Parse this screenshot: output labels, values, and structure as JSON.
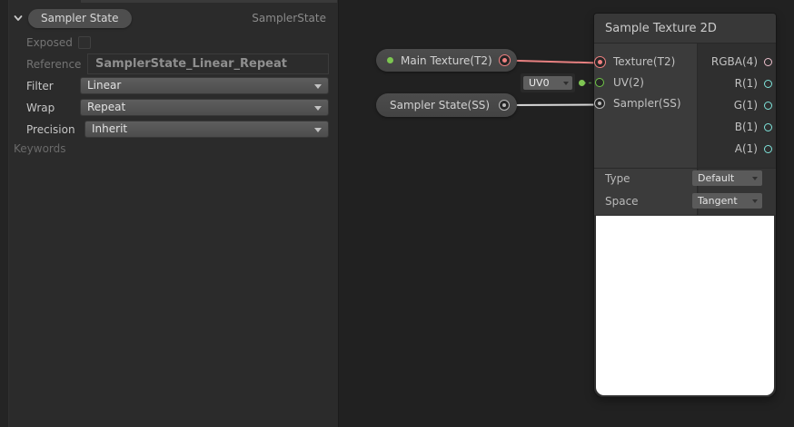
{
  "colors": {
    "graph_background": "#212121",
    "panel_background": "#2b2b2b",
    "node_header": "#383838",
    "node_body": "#2f2f2f",
    "input_column": "#3b3b3b",
    "pill_background": "#484848",
    "texture_port": "#f08080",
    "uv_port": "#6fc846",
    "exposed_dot_green": "#7cc651",
    "sampler_port": "#b9b9b9",
    "vector4_port": "#eec1ce",
    "float_port": "#7fe5dc",
    "edge_texture": "#e88181",
    "edge_uv_dashed": "#4e7c40",
    "edge_sampler": "#d9d9d9",
    "preview_background": "#ffffff"
  },
  "inspector": {
    "property_pill_label": "Sampler State",
    "property_type_label": "SamplerState",
    "exposed_label": "Exposed",
    "reference_label": "Reference",
    "reference_value": "SamplerState_Linear_Repeat",
    "filter_label": "Filter",
    "filter_value": "Linear",
    "wrap_label": "Wrap",
    "wrap_value": "Repeat",
    "precision_label": "Precision",
    "precision_value": "Inherit",
    "keywords_label": "Keywords"
  },
  "graph": {
    "main_texture_node": {
      "label": "Main Texture(T2)"
    },
    "uv_dropdown": {
      "value": "UV0"
    },
    "sampler_state_node": {
      "label": "Sampler State(SS)"
    },
    "sample_texture_node": {
      "title": "Sample Texture 2D",
      "inputs": [
        {
          "label": "Texture(T2)"
        },
        {
          "label": "UV(2)"
        },
        {
          "label": "Sampler(SS)"
        }
      ],
      "outputs": [
        {
          "label": "RGBA(4)"
        },
        {
          "label": "R(1)"
        },
        {
          "label": "G(1)"
        },
        {
          "label": "B(1)"
        },
        {
          "label": "A(1)"
        }
      ],
      "type_label": "Type",
      "type_value": "Default",
      "space_label": "Space",
      "space_value": "Tangent"
    }
  }
}
